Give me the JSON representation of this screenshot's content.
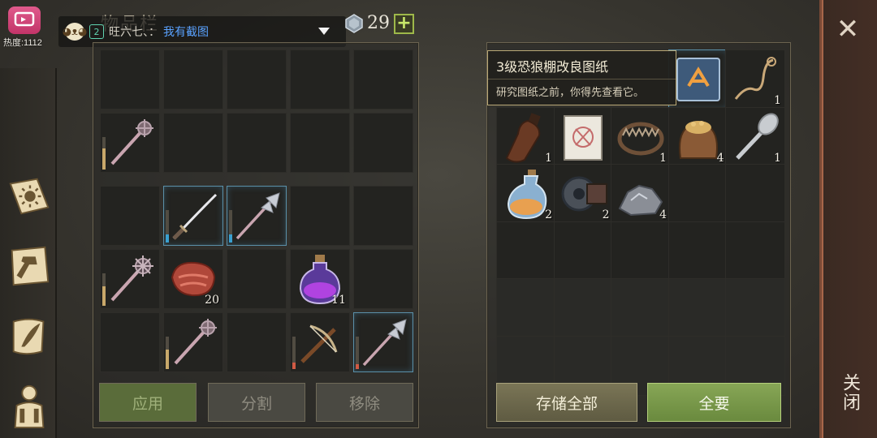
{
  "stream": {
    "heat": "热度:1112"
  },
  "chat": {
    "level": "2",
    "name": "旺六七、：",
    "message": "我有截图"
  },
  "inventory": {
    "title": "物品栏",
    "gems": "29",
    "slots": [
      {
        "row": 0,
        "col": 0
      },
      {
        "row": 0,
        "col": 1
      },
      {
        "row": 0,
        "col": 2
      },
      {
        "row": 0,
        "col": 3
      },
      {
        "row": 0,
        "col": 4
      },
      {
        "row": 1,
        "col": 0,
        "item": "mace-icon",
        "durability": 0.65,
        "dur_color": "#c8a86a"
      },
      {
        "row": 1,
        "col": 1
      },
      {
        "row": 1,
        "col": 2
      },
      {
        "row": 1,
        "col": 3
      },
      {
        "row": 1,
        "col": 4
      },
      {
        "row": 2,
        "col": 0
      },
      {
        "row": 2,
        "col": 1,
        "item": "katana-icon",
        "durability": 0.25,
        "dur_color": "#3aa0d0",
        "selected": true
      },
      {
        "row": 2,
        "col": 2,
        "item": "halberd-icon",
        "durability": 0.25,
        "dur_color": "#3aa0d0",
        "selected": true
      },
      {
        "row": 2,
        "col": 3
      },
      {
        "row": 2,
        "col": 4
      },
      {
        "row": 3,
        "col": 0,
        "item": "spiked-mace-icon",
        "durability": 0.6,
        "dur_color": "#c8a86a"
      },
      {
        "row": 3,
        "col": 1,
        "item": "meat-icon",
        "qty": "20"
      },
      {
        "row": 3,
        "col": 2
      },
      {
        "row": 3,
        "col": 3,
        "item": "purple-potion-icon",
        "qty": "11"
      },
      {
        "row": 3,
        "col": 4
      },
      {
        "row": 4,
        "col": 0
      },
      {
        "row": 4,
        "col": 1,
        "item": "mace-icon",
        "durability": 0.6,
        "dur_color": "#c8a86a"
      },
      {
        "row": 4,
        "col": 2
      },
      {
        "row": 4,
        "col": 3,
        "item": "crossbow-icon",
        "durability": 0.2,
        "dur_color": "#d05a44"
      },
      {
        "row": 4,
        "col": 4,
        "item": "halberd-icon",
        "durability": 0.15,
        "dur_color": "#d05a44",
        "selected": true
      }
    ],
    "buttons": {
      "apply": "应用",
      "split": "分割",
      "remove": "移除"
    }
  },
  "storage": {
    "slots": [
      {
        "row": 0,
        "col": 3,
        "item": "blueprint-book-icon",
        "selected": true
      },
      {
        "row": 0,
        "col": 4,
        "item": "rope-icon",
        "qty": "1"
      },
      {
        "row": 1,
        "col": 0,
        "item": "bottle-icon",
        "qty": "1"
      },
      {
        "row": 1,
        "col": 1,
        "item": "blueprint-paper-icon"
      },
      {
        "row": 1,
        "col": 2,
        "item": "bear-trap-icon",
        "qty": "1"
      },
      {
        "row": 1,
        "col": 3,
        "item": "grain-sack-icon",
        "qty": "4"
      },
      {
        "row": 1,
        "col": 4,
        "item": "spoon-icon",
        "qty": "1"
      },
      {
        "row": 2,
        "col": 0,
        "item": "orange-potion-icon",
        "qty": "2"
      },
      {
        "row": 2,
        "col": 1,
        "item": "gear-part-icon",
        "qty": "2"
      },
      {
        "row": 2,
        "col": 2,
        "item": "iron-ore-icon",
        "qty": "4"
      },
      {
        "row": 2,
        "col": 3
      },
      {
        "row": 2,
        "col": 4
      },
      {
        "row": 3,
        "col": 0
      },
      {
        "row": 3,
        "col": 1
      },
      {
        "row": 3,
        "col": 2
      },
      {
        "row": 3,
        "col": 3
      },
      {
        "row": 3,
        "col": 4
      },
      {
        "row": 4,
        "col": 0,
        "dim": true
      },
      {
        "row": 4,
        "col": 1,
        "dim": true
      },
      {
        "row": 4,
        "col": 2,
        "dim": true
      },
      {
        "row": 4,
        "col": 3,
        "dim": true
      },
      {
        "row": 4,
        "col": 4,
        "dim": true
      },
      {
        "row": 5,
        "col": 0,
        "dim": true
      },
      {
        "row": 5,
        "col": 1,
        "dim": true
      },
      {
        "row": 5,
        "col": 2,
        "dim": true
      },
      {
        "row": 5,
        "col": 3,
        "dim": true
      },
      {
        "row": 5,
        "col": 4,
        "dim": true
      }
    ],
    "tooltip": {
      "title": "3级恐狼棚改良图纸",
      "desc": "研究图纸之前，你得先查看它。"
    },
    "buttons": {
      "store_all": "存储全部",
      "take_all": "全要"
    }
  },
  "close": {
    "label": "关闭"
  }
}
